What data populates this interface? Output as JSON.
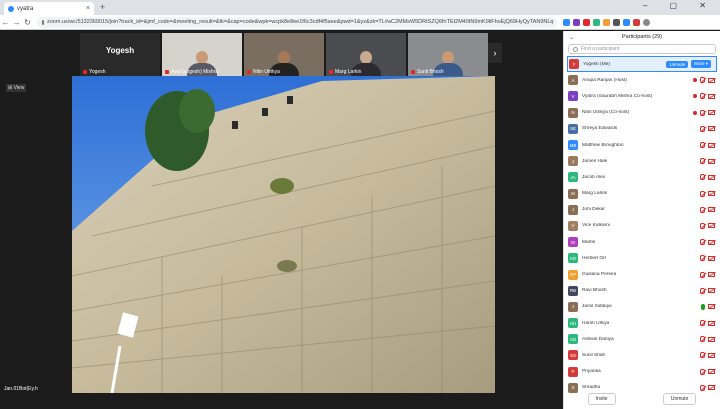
{
  "browser": {
    "tab_title": "vyatra",
    "url": "zoom.us/wc/5132369015/join?track_id=&jmf_code=&meeting_result=&tk=&cap=code&wpk=wcpk8e8ee1f6c3cdf4f5aee&pwd=1&yz&zk=TL#aC2MMsW5DRtSZQ6fnTEt2M40tN9mK9liFhoEjQ69HyQyTAN9NLq",
    "new_tab": "+",
    "window_controls": "– ▢ ✕"
  },
  "thumbnails": [
    {
      "name": "Yogesh",
      "label": "Yogesh"
    },
    {
      "name": "Ayat (yogesh) Mishra"
    },
    {
      "name": "Nitin Utrikya"
    },
    {
      "name": "Marg Larkin"
    },
    {
      "name": "Sunil Bhosh"
    }
  ],
  "view_tag": "⊞ View",
  "share_owner": "Jan.01Bot(Ey.h",
  "participants": {
    "title": "Participants (29)",
    "search_placeholder": "Find a participant",
    "unmute": "Unmute",
    "more": "More ▾",
    "footer": [
      "Invite",
      "Unmute"
    ],
    "list": [
      {
        "initial": "Y",
        "name": "Yogesh (Me)",
        "color": "#d63b3b",
        "selected": true
      },
      {
        "initial": "A",
        "name": "Anupa Ranjan (Host)",
        "color": "#8a6f55",
        "rec": true
      },
      {
        "initial": "V",
        "name": "Vyatra (Saurabh Mishra Co-host)",
        "color": "#7b3fbf",
        "rec": true
      },
      {
        "initial": "N",
        "name": "Nitin Utrikya (Co-host)",
        "color": "#8a6f55",
        "rec": true
      },
      {
        "initial": "SE",
        "name": "Shreya Edwards",
        "color": "#4a6fa5"
      },
      {
        "initial": "MB",
        "name": "Matthew Broughton",
        "color": "#2d8cff"
      },
      {
        "initial": "J",
        "name": "James Hale",
        "color": "#9a7b60"
      },
      {
        "initial": "JA",
        "name": "Jacob Alex",
        "color": "#2db87d"
      },
      {
        "initial": "M",
        "name": "Marg Larkin",
        "color": "#8a6f55"
      },
      {
        "initial": "J",
        "name": "Juhi Dekar",
        "color": "#8a6f55"
      },
      {
        "initial": "V",
        "name": "Vice Kulkarni",
        "color": "#a08060"
      },
      {
        "initial": "M",
        "name": "Martin",
        "color": "#b03fbf"
      },
      {
        "initial": "HO",
        "name": "Herbert Orr",
        "color": "#2db87d"
      },
      {
        "initial": "GP",
        "name": "Giuliana Pereira",
        "color": "#f0a030"
      },
      {
        "initial": "RB",
        "name": "Ravi Bhosh",
        "color": "#404860"
      },
      {
        "initial": "J",
        "name": "Jamil Siddiqui",
        "color": "#8a6f55",
        "mic_on": true
      },
      {
        "initial": "HU",
        "name": "Harsh Ulhiya",
        "color": "#2db87d"
      },
      {
        "initial": "AD",
        "name": "Ashwin Daniya",
        "color": "#2db87d"
      },
      {
        "initial": "SS",
        "name": "Sunil Shah",
        "color": "#d63b3b"
      },
      {
        "initial": "P",
        "name": "Priyanka",
        "color": "#d63b3b"
      },
      {
        "initial": "S",
        "name": "Shradha",
        "color": "#8a6f55"
      }
    ]
  }
}
